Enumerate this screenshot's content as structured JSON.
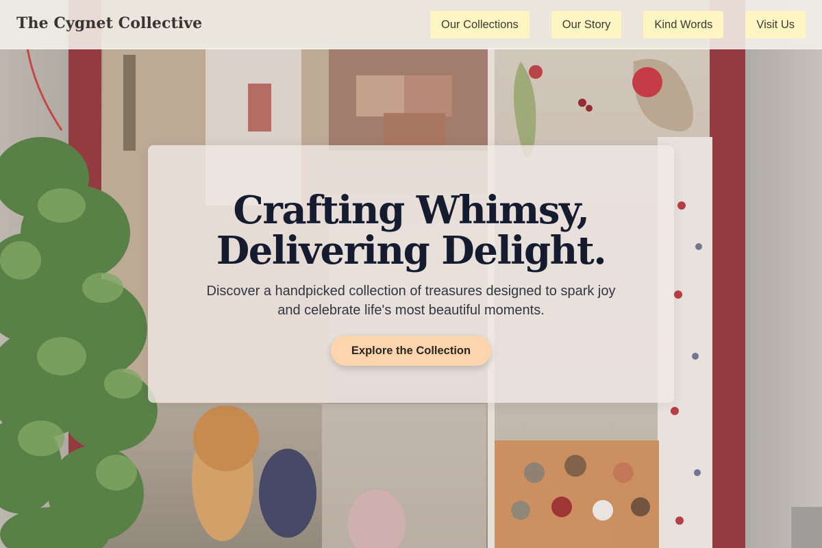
{
  "brand": {
    "name": "The Cygnet Collective"
  },
  "nav": {
    "items": [
      {
        "label": "Our Collections"
      },
      {
        "label": "Our Story"
      },
      {
        "label": "Kind Words"
      },
      {
        "label": "Visit Us"
      }
    ]
  },
  "hero": {
    "title_line1": "Crafting Whimsy,",
    "title_line2": "Delivering Delight.",
    "subtitle": "Discover a handpicked collection of treasures designed to spark joy and celebrate life's most beautiful moments.",
    "cta_label": "Explore the Collection"
  },
  "colors": {
    "nav_button_bg": "#fdf6c3",
    "cta_bg": "#fdd5ad",
    "title_text": "#161c30",
    "door_frame": "#8d2f33"
  }
}
